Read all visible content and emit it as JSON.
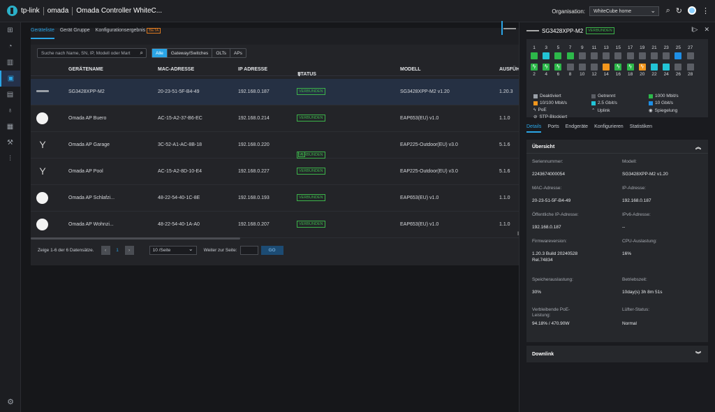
{
  "topbar": {
    "brand": "tp-link",
    "product": "omada",
    "app_title": "Omada Controller WhiteC...",
    "org_label": "Organisation:",
    "org_value": "WhiteCube home"
  },
  "sidebar": {
    "items": [
      "dashboard-icon",
      "statistics-icon",
      "map-icon",
      "devices-icon",
      "clients-icon",
      "insight-icon",
      "logs-icon",
      "tools-icon",
      "reports-icon"
    ],
    "active": "devices-icon"
  },
  "tabs": [
    {
      "label": "Geräteliste",
      "active": true
    },
    {
      "label": "Gerät Gruppe",
      "active": false
    },
    {
      "label": "Konfigurationsergebnis",
      "active": false,
      "badge": "BETA"
    }
  ],
  "search": {
    "placeholder": "Suche nach Name, SN, IP, Modell oder Mart"
  },
  "filters": [
    {
      "label": "Alle",
      "active": true
    },
    {
      "label": "Gateway/Switches",
      "active": false
    },
    {
      "label": "OLTs",
      "active": false
    },
    {
      "label": "APs",
      "active": false
    }
  ],
  "table": {
    "headers": [
      "GERÄTENAME",
      "MAC-ADRESSE",
      "IP ADRESSE",
      "STATUS",
      "MODELL",
      "AUSFÜH"
    ],
    "rows": [
      {
        "icon": "switch",
        "name": "SG3428XPP-M2",
        "mac": "20-23-51-5F-B4-49",
        "ip": "192.168.0.187",
        "status": "VERBUNDEN",
        "model": "SG3428XPP-M2 v1.20",
        "fw": "1.20.3",
        "selected": true
      },
      {
        "icon": "ap",
        "name": "Omada AP Buero",
        "mac": "AC-15-A2-37-B6-EC",
        "ip": "192.168.0.214",
        "status": "VERBUNDEN",
        "model": "EAP653(EU) v1.0",
        "fw": "1.1.0"
      },
      {
        "icon": "outdoor",
        "name": "Omada AP Garage",
        "mac": "3C-52-A1-AC-8B-18",
        "ip": "192.168.0.220",
        "status": "VERBUNDEN",
        "model": "EAP225-Outdoor(EU) v3.0",
        "fw": "5.1.6",
        "wifi": true
      },
      {
        "icon": "outdoor",
        "name": "Omada AP Pool",
        "mac": "AC-15-A2-8D-10-E4",
        "ip": "192.168.0.227",
        "status": "VERBUNDEN",
        "model": "EAP225-Outdoor(EU) v3.0",
        "fw": "5.1.6"
      },
      {
        "icon": "ap",
        "name": "Omada AP Schlafzi...",
        "mac": "48-22-54-40-1C-8E",
        "ip": "192.168.0.193",
        "status": "VERBUNDEN",
        "model": "EAP653(EU) v1.0",
        "fw": "1.1.0"
      },
      {
        "icon": "ap",
        "name": "Omada AP Wohnzi...",
        "mac": "48-22-54-40-1A-A0",
        "ip": "192.168.0.207",
        "status": "VERBUNDEN",
        "model": "EAP653(EU) v1.0",
        "fw": "1.1.0"
      }
    ]
  },
  "pager": {
    "summary": "Zeige 1-6 der 6 Datensätze.",
    "current": "1",
    "per_page": "10 /Seite",
    "goto_label": "Weiter zur Seite:",
    "go": "GO"
  },
  "detail": {
    "device_name": "SG3428XPP-M2",
    "status": "VERBUNDEN",
    "ports_top": [
      "1",
      "3",
      "5",
      "7",
      "9",
      "11",
      "13",
      "15",
      "17",
      "19",
      "21",
      "23",
      "25",
      "27"
    ],
    "ports_bottom": [
      "2",
      "4",
      "6",
      "8",
      "10",
      "12",
      "14",
      "16",
      "18",
      "20",
      "22",
      "24",
      "26",
      "28"
    ],
    "ports_top_states": [
      "green",
      "cyan",
      "green",
      "green",
      "grey",
      "grey",
      "grey",
      "grey",
      "grey",
      "grey",
      "grey",
      "grey",
      "blue",
      "grey"
    ],
    "ports_bottom_states": [
      "green-poe",
      "green-poe",
      "green-poe",
      "grey",
      "grey",
      "grey",
      "orange",
      "green-poe",
      "green-poe",
      "orange-poe",
      "cyan",
      "cyan",
      "grey",
      "grey"
    ],
    "legend": {
      "deactivated": "Deaktiviert",
      "disconnected": "Getrennt",
      "g1000": "1000 Mbit/s",
      "m10_100": "10/100 Mbit/s",
      "g25": "2.5 Gbit/s",
      "g10": "10 Gbit/s",
      "poe": "PoE",
      "uplink": "Uplink",
      "mirror": "Spiegelung",
      "stp": "STP-Blockiert"
    },
    "colors": {
      "grey": "#5b5e65",
      "green": "#2db84a",
      "orange": "#f2961d",
      "cyan": "#22c4d6",
      "blue": "#1e8fe6"
    },
    "tabs": [
      {
        "label": "Details",
        "active": true
      },
      {
        "label": "Ports",
        "active": false
      },
      {
        "label": "Endgeräte",
        "active": false
      },
      {
        "label": "Konfigurieren",
        "active": false
      },
      {
        "label": "Statistiken",
        "active": false
      }
    ],
    "overview_title": "Übersicht",
    "fields": {
      "serial_label": "Seriennummer:",
      "serial": "2243674000054",
      "model_label": "Modell:",
      "model": "SG3428XPP-M2 v1.20",
      "mac_label": "MAC-Adresse:",
      "mac": "20-23-51-5F-B4-49",
      "ip_label": "IP-Adresse:",
      "ip": "192.168.0.187",
      "public_ip_label": "Öffentliche IP-Adresse:",
      "public_ip": "192.168.0.187",
      "ipv6_label": "IPv6-Adresse:",
      "ipv6": "--",
      "fw_label": "Firmwareversion:",
      "fw": "1.20.3 Build 20240528 Rel.74834",
      "cpu_label": "CPU-Auslastung:",
      "cpu": "16%",
      "mem_label": "Speicherauslastung:",
      "mem": "30%",
      "uptime_label": "Betriebszeit:",
      "uptime": "10day(s) 3h 8m 51s",
      "poe_label": "Verbleibende PoE-Leistung:",
      "poe": "94.18% / 470.90W",
      "fan_label": "Lüfter-Status:",
      "fan": "Normal"
    },
    "downlink": "Downlink"
  }
}
